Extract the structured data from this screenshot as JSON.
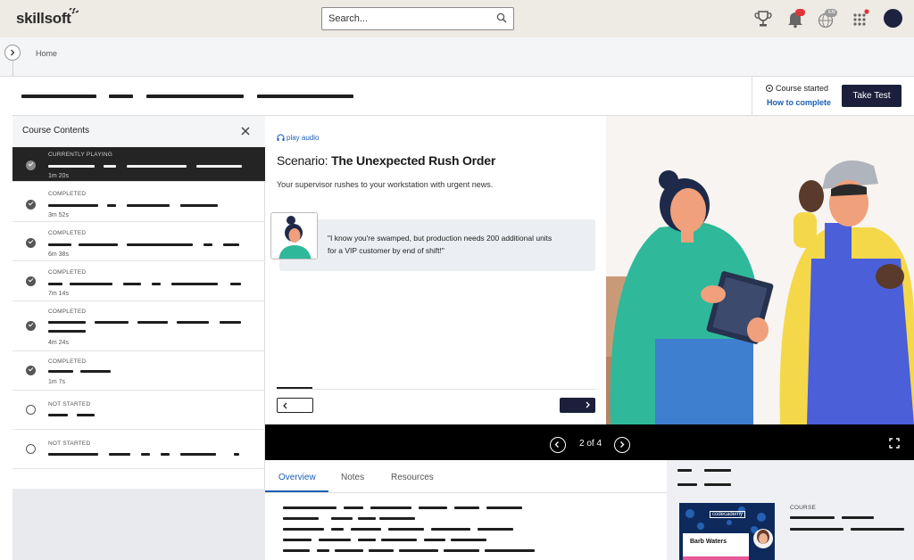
{
  "header": {
    "logo_text": "skillsoft",
    "search_placeholder": "Search...",
    "language_badge": "EN"
  },
  "breadcrumb": {
    "home": "Home"
  },
  "course": {
    "status_text": "Course started",
    "how_to_complete": "How to complete",
    "take_test_label": "Take Test"
  },
  "sidebar": {
    "title": "Course Contents",
    "lessons": [
      {
        "status": "CURRENTLY PLAYING",
        "duration": "1m 20s",
        "state": "current"
      },
      {
        "status": "COMPLETED",
        "duration": "3m 52s",
        "state": "completed"
      },
      {
        "status": "COMPLETED",
        "duration": "6m 38s",
        "state": "completed"
      },
      {
        "status": "COMPLETED",
        "duration": "7m 14s",
        "state": "completed"
      },
      {
        "status": "COMPLETED",
        "duration": "4m 24s",
        "state": "completed"
      },
      {
        "status": "COMPLETED",
        "duration": "1m 7s",
        "state": "completed"
      },
      {
        "status": "NOT STARTED",
        "duration": "",
        "state": "not-started"
      },
      {
        "status": "NOT STARTED",
        "duration": "",
        "state": "not-started"
      }
    ]
  },
  "slide": {
    "play_audio": "play audio",
    "scenario_prefix": "Scenario:",
    "scenario_title": "The Unexpected Rush Order",
    "subtitle": "Your supervisor rushes to your workstation with urgent news.",
    "quote": "\"I know you're swamped, but production needs 200 additional units for a VIP customer by end of shift!\""
  },
  "player": {
    "pager": "2 of 4"
  },
  "tabs": [
    {
      "label": "Overview",
      "active": true
    },
    {
      "label": "Notes",
      "active": false
    },
    {
      "label": "Resources",
      "active": false
    }
  ],
  "related": {
    "course_label": "COURSE",
    "thumb_brand": "codecademy",
    "thumb_name": "Barb Waters"
  },
  "colors": {
    "accent_blue": "#1a5fb4",
    "navy": "#1b1f3b",
    "topbar_bg": "#eeeae4",
    "notification_red": "#e0353b"
  }
}
